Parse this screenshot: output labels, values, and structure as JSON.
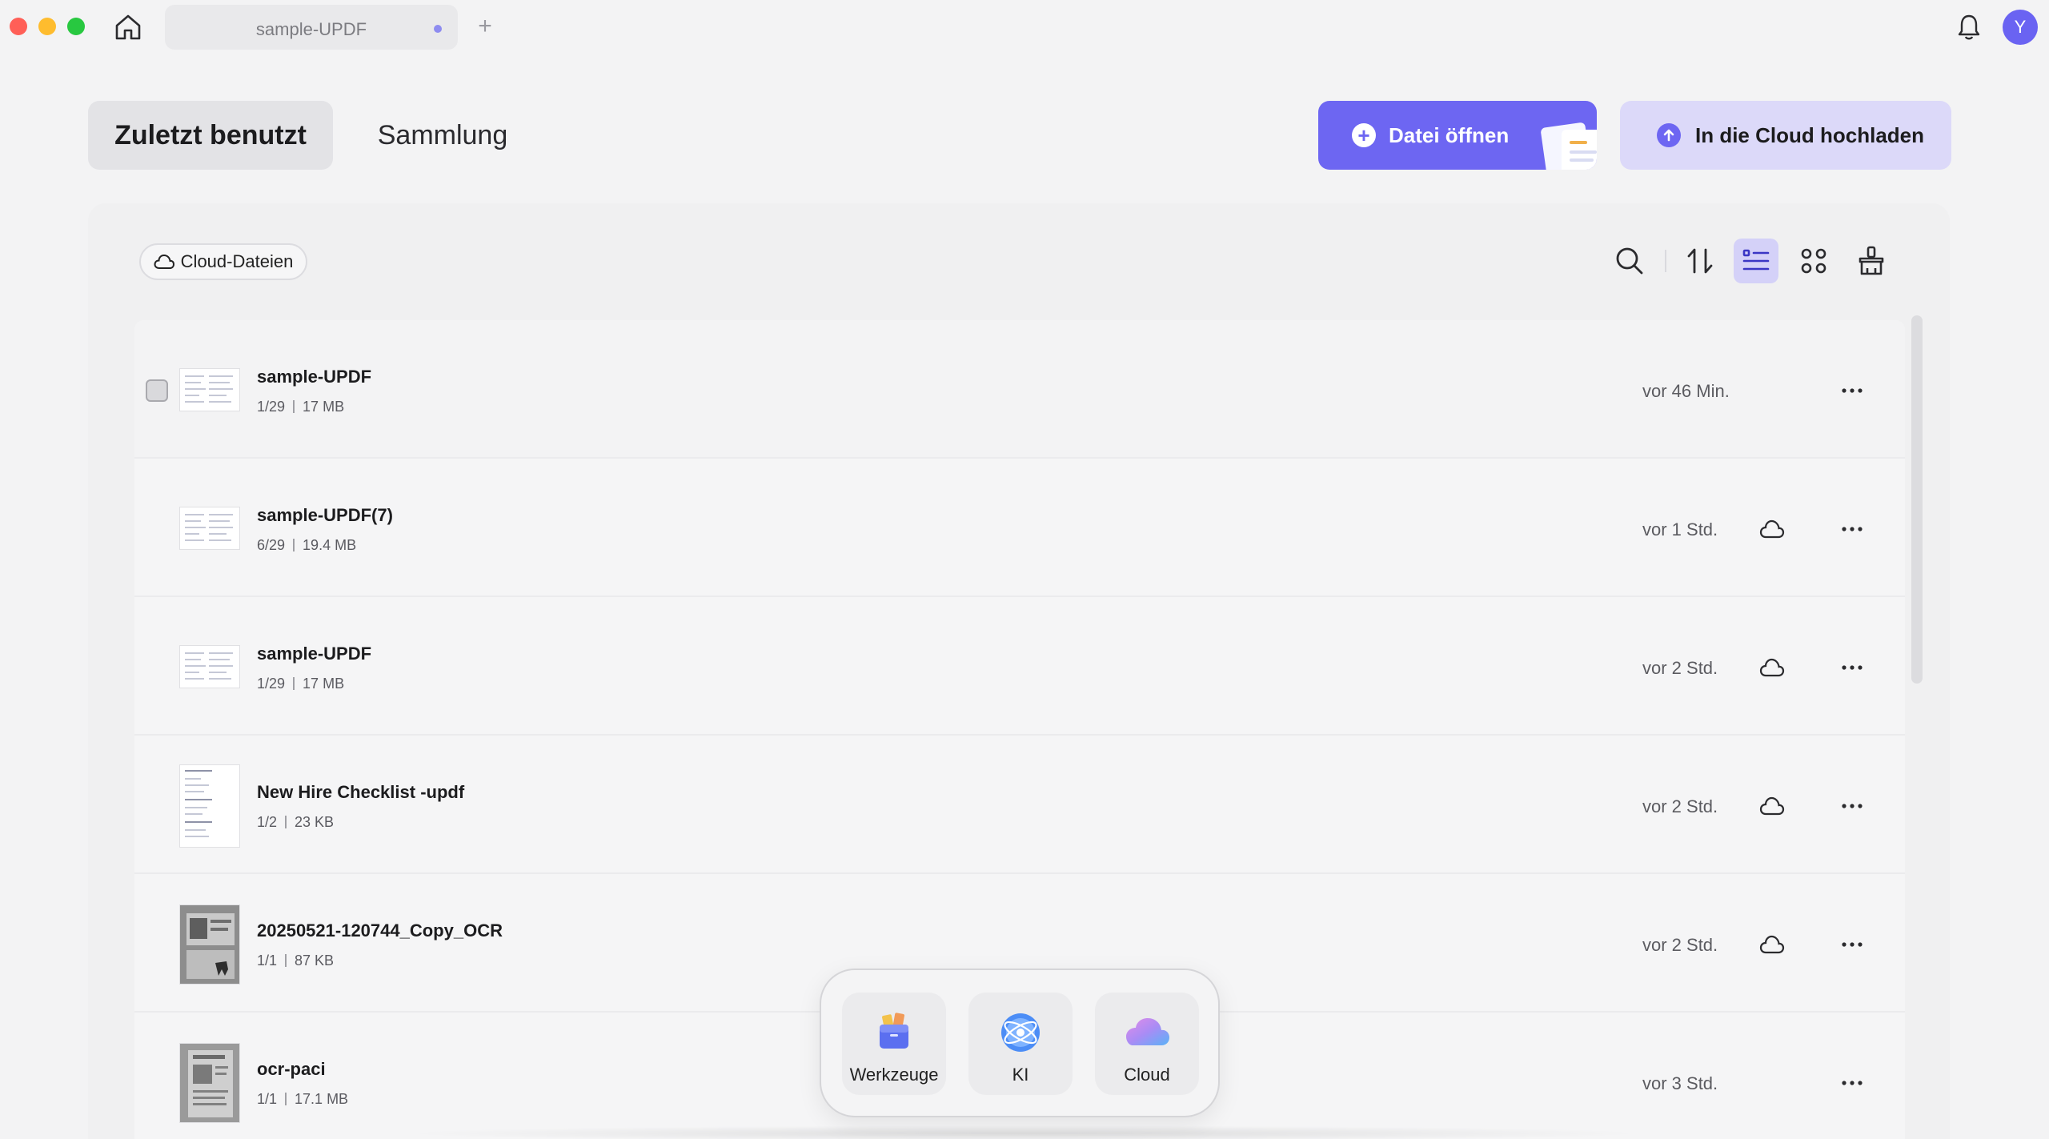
{
  "window": {
    "tab_title": "sample-UPDF",
    "new_tab": "+",
    "avatar_initial": "Y"
  },
  "header": {
    "tab_recent": "Zuletzt benutzt",
    "tab_collection": "Sammlung",
    "open_file": "Datei öffnen",
    "upload_cloud": "In die Cloud hochladen",
    "open_file_plus": "+"
  },
  "toolbar": {
    "cloud_files": "Cloud-Dateien"
  },
  "files": [
    {
      "name": "sample-UPDF",
      "pages": "1/29",
      "size": "17 MB",
      "time": "vor 46 Min.",
      "cloud": false,
      "thumb": "doc"
    },
    {
      "name": "sample-UPDF(7)",
      "pages": "6/29",
      "size": "19.4 MB",
      "time": "vor 1 Std.",
      "cloud": true,
      "thumb": "doc"
    },
    {
      "name": "sample-UPDF",
      "pages": "1/29",
      "size": "17 MB",
      "time": "vor 2 Std.",
      "cloud": true,
      "thumb": "doc"
    },
    {
      "name": "New Hire Checklist -updf",
      "pages": "1/2",
      "size": "23 KB",
      "time": "vor 2 Std.",
      "cloud": true,
      "thumb": "checklist"
    },
    {
      "name": "20250521-120744_Copy_OCR",
      "pages": "1/1",
      "size": "87 KB",
      "time": "vor 2 Std.",
      "cloud": true,
      "thumb": "photo"
    },
    {
      "name": "ocr-paci",
      "pages": "1/1",
      "size": "17.1 MB",
      "time": "vor 3 Std.",
      "cloud": false,
      "thumb": "photo"
    }
  ],
  "dock": {
    "tools": "Werkzeuge",
    "ai": "KI",
    "cloud": "Cloud"
  },
  "colors": {
    "accent": "#6d66f2",
    "accent_light": "#dcd9f9",
    "active_view": "#d4d1f8"
  }
}
